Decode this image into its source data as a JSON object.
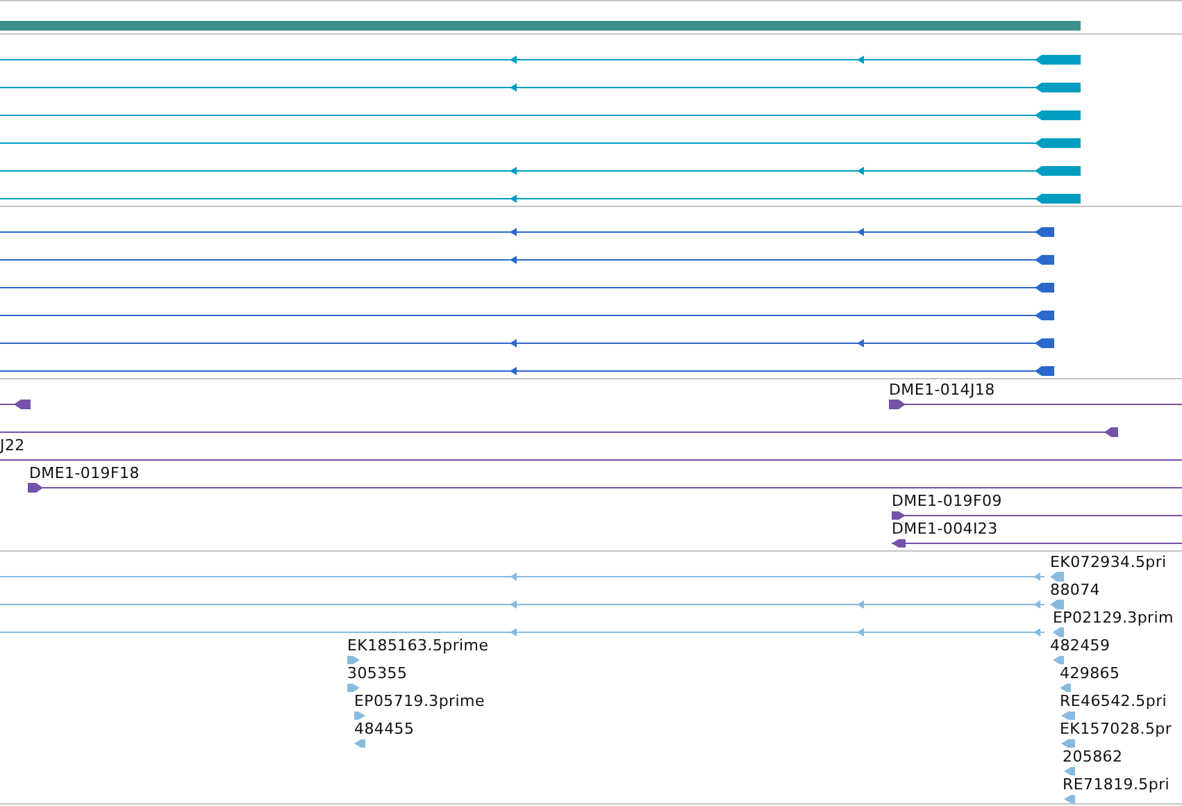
{
  "tracks": [
    {
      "kind": "gene",
      "color": "#3f8f8f"
    },
    {
      "kind": "transcripts",
      "color": "#009dc0",
      "rows": [
        {
          "reverse": true
        },
        {
          "reverse": true
        },
        {
          "reverse": true
        },
        {
          "reverse": true
        },
        {
          "reverse": true
        },
        {
          "reverse": true
        }
      ]
    },
    {
      "kind": "transcripts",
      "color": "#2a68cc",
      "rows": [
        {
          "reverse": true
        },
        {
          "reverse": true
        },
        {
          "reverse": true
        },
        {
          "reverse": true
        },
        {
          "reverse": true
        },
        {
          "reverse": true
        }
      ]
    },
    {
      "kind": "clones",
      "color": "#7352a8",
      "features": [
        {
          "reverse": true
        },
        {
          "label": "DME1-014J18",
          "reverse": false
        },
        {
          "reverse": true
        },
        {
          "label": "J22"
        },
        {
          "label": "DME1-019F18",
          "reverse": false
        },
        {
          "label": "DME1-019F09",
          "reverse": false
        },
        {
          "label": "DME1-004I23",
          "reverse": true
        }
      ]
    },
    {
      "kind": "ests",
      "color": "#88bbde",
      "features": [
        {
          "label": "EK072934.5pri",
          "reverse": true
        },
        {
          "label": "88074",
          "reverse": true
        },
        {
          "label": "EP02129.3prim",
          "reverse": true
        },
        {
          "label": "EK185163.5prime",
          "reverse": false
        },
        {
          "label": "482459",
          "reverse": true
        },
        {
          "label": "305355",
          "reverse": false
        },
        {
          "label": "429865",
          "reverse": true
        },
        {
          "label": "EP05719.3prime",
          "reverse": false
        },
        {
          "label": "RE46542.5pri",
          "reverse": true
        },
        {
          "label": "484455",
          "reverse": true
        },
        {
          "label": "EK157028.5pr",
          "reverse": true
        },
        {
          "label": "205862",
          "reverse": true
        },
        {
          "label": "RE71819.5pri",
          "reverse": true
        }
      ]
    }
  ]
}
